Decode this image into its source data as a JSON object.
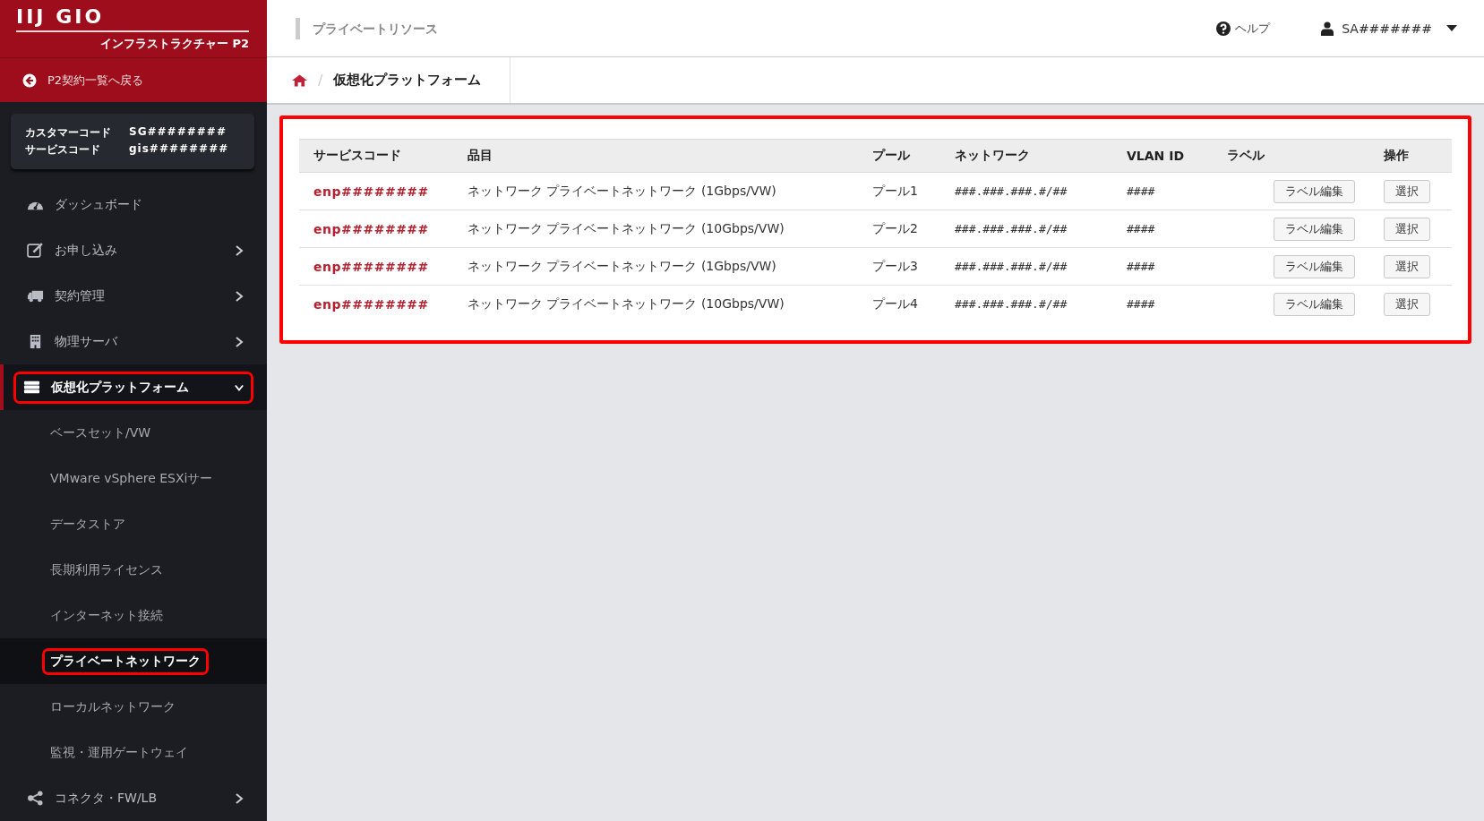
{
  "brand": {
    "logo": "IIJ GIO",
    "subtitle": "インフラストラクチャー P2"
  },
  "back_link": "P2契約一覧へ戻る",
  "account": [
    {
      "label": "カスタマーコード",
      "value": "SG########"
    },
    {
      "label": "サービスコード",
      "value": "gis########"
    }
  ],
  "sidebar": {
    "items": [
      {
        "label": "ダッシュボード",
        "selected": false,
        "highlighted": false
      },
      {
        "label": "お申し込み",
        "selected": false,
        "highlighted": false,
        "expanded": false
      },
      {
        "label": "契約管理",
        "selected": false,
        "highlighted": false,
        "expanded": false
      },
      {
        "label": "物理サーバ",
        "selected": false,
        "highlighted": false,
        "expanded": false
      },
      {
        "label": "仮想化プラットフォーム",
        "selected": true,
        "highlighted": true,
        "expanded": true,
        "children": [
          {
            "label": "ベースセット/VW",
            "selected": false,
            "highlighted": false
          },
          {
            "label": "VMware vSphere ESXiサー",
            "selected": false,
            "highlighted": false
          },
          {
            "label": "データストア",
            "selected": false,
            "highlighted": false
          },
          {
            "label": "長期利用ライセンス",
            "selected": false,
            "highlighted": false
          },
          {
            "label": "インターネット接続",
            "selected": false,
            "highlighted": false
          },
          {
            "label": "プライベートネットワーク",
            "selected": true,
            "highlighted": true
          },
          {
            "label": "ローカルネットワーク",
            "selected": false,
            "highlighted": false
          },
          {
            "label": "監視・運用ゲートウェイ",
            "selected": false,
            "highlighted": false
          }
        ]
      },
      {
        "label": "コネクタ・FW/LB",
        "selected": false,
        "highlighted": false,
        "expanded": false
      }
    ]
  },
  "header": {
    "title": "プライベートリソース",
    "help": "ヘルプ",
    "user": "SA#######"
  },
  "breadcrumb": {
    "separator": "/",
    "items": [
      "仮想化プラットフォーム"
    ]
  },
  "panel": {
    "highlighted": true,
    "columns": [
      "サービスコード",
      "品目",
      "プール",
      "ネットワーク",
      "VLAN ID",
      "ラベル",
      "操作"
    ],
    "rows": [
      {
        "service_code": "enp########",
        "item": "ネットワーク プライベートネットワーク (1Gbps/VW)",
        "pool": "プール1",
        "network": "###.###.###.#/##",
        "vlan_id": "####",
        "label_button": "ラベル編集",
        "action_button": "選択"
      },
      {
        "service_code": "enp########",
        "item": "ネットワーク プライベートネットワーク (10Gbps/VW)",
        "pool": "プール2",
        "network": "###.###.###.#/##",
        "vlan_id": "####",
        "label_button": "ラベル編集",
        "action_button": "選択"
      },
      {
        "service_code": "enp########",
        "item": "ネットワーク プライベートネットワーク (1Gbps/VW)",
        "pool": "プール3",
        "network": "###.###.###.#/##",
        "vlan_id": "####",
        "label_button": "ラベル編集",
        "action_button": "選択"
      },
      {
        "service_code": "enp########",
        "item": "ネットワーク プライベートネットワーク (10Gbps/VW)",
        "pool": "プール4",
        "network": "###.###.###.#/##",
        "vlan_id": "####",
        "label_button": "ラベル編集",
        "action_button": "選択"
      }
    ]
  }
}
